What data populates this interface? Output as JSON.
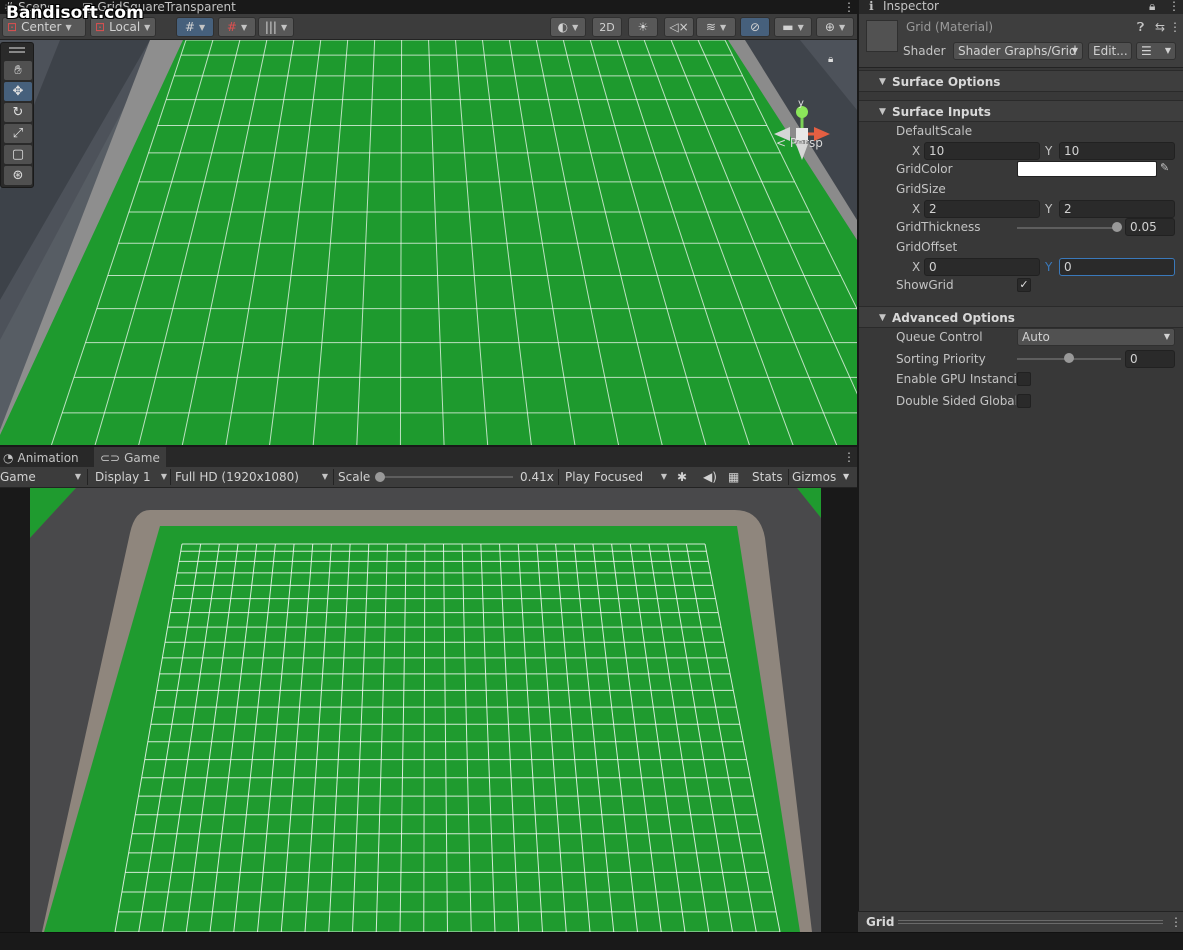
{
  "watermark": "Bandisoft.com",
  "scene": {
    "tabs": [
      {
        "label": "Scene"
      },
      {
        "label": "GridSquareTransparent"
      }
    ],
    "toolbar": {
      "pivot_label": "Center",
      "space_label": "Local",
      "toggle_2d_label": "2D"
    },
    "persp_label": "< Persp",
    "tools": [
      "hand-tool",
      "move-tool",
      "rotate-tool",
      "scale-tool",
      "rect-tool",
      "transform-tool"
    ]
  },
  "game": {
    "tabs": [
      {
        "label": "Animation"
      },
      {
        "label": "Game"
      }
    ],
    "toolbar": {
      "mode_label": "Game",
      "display_label": "Display 1",
      "resolution_label": "Full HD (1920x1080)",
      "scale_label": "Scale",
      "scale_value": "0.41x",
      "scale_level": 0.0,
      "play_mode_label": "Play Focused",
      "stats_label": "Stats",
      "gizmos_label": "Gizmos"
    }
  },
  "inspector": {
    "tab_label": "Inspector",
    "material_name": "Grid (Material)",
    "shader_label": "Shader",
    "shader_value": "Shader Graphs/Grid",
    "edit_label": "Edit...",
    "sections": {
      "surface_options": "Surface Options",
      "surface_inputs": "Surface Inputs",
      "advanced_options": "Advanced Options"
    },
    "properties": {
      "default_scale": {
        "label": "DefaultScale",
        "x_label": "X",
        "x": "10",
        "y_label": "Y",
        "y": "10"
      },
      "grid_color": {
        "label": "GridColor",
        "value": "#ffffff"
      },
      "grid_size": {
        "label": "GridSize",
        "x_label": "X",
        "x": "2",
        "y_label": "Y",
        "y": "2"
      },
      "grid_thickness": {
        "label": "GridThickness",
        "value": "0.05",
        "level": 1.0
      },
      "grid_offset": {
        "label": "GridOffset",
        "x_label": "X",
        "x": "0",
        "y_label": "Y",
        "y": "0"
      },
      "show_grid": {
        "label": "ShowGrid",
        "checked": "✓"
      }
    },
    "advanced": {
      "queue_control": {
        "label": "Queue Control",
        "value": "Auto"
      },
      "sorting_priority": {
        "label": "Sorting Priority",
        "value": "0",
        "level": 0.5
      },
      "gpu_instancing": {
        "label": "Enable GPU Instancin"
      },
      "double_sided_gi": {
        "label": "Double Sided Global I"
      }
    },
    "footer_label": "Grid"
  },
  "colors": {
    "grass": "#1e9a2e",
    "grid_line": "#ffffff",
    "accent": "#46607c",
    "focus": "#3a79bb"
  }
}
